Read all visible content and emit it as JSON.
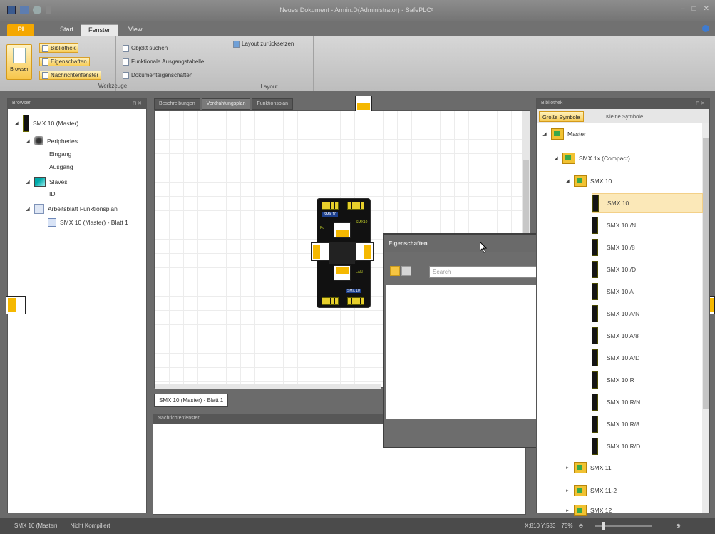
{
  "window": {
    "title": "Neues Dokument - Armin.D(Administrator) - SafePLC²",
    "controls": [
      "–",
      "□",
      "✕"
    ]
  },
  "ribbon": {
    "tabs": [
      "Pl",
      "Start",
      "Fenster",
      "View"
    ],
    "browser_button": "Browser",
    "group_werkzeuge": {
      "title": "Werkzeuge",
      "items": [
        "Bibliothek",
        "Eigenschaften",
        "Nachrichtenfenster"
      ]
    },
    "group_more": {
      "items": [
        "Objekt suchen",
        "Funktionale Ausgangstabelle",
        "Dokumenteigenschaften"
      ]
    },
    "group_layout": {
      "title": "Layout",
      "items": [
        "Layout zurücksetzen"
      ]
    }
  },
  "left_panel": {
    "title": "Browser",
    "tree": [
      {
        "label": "SMX 10 (Master)"
      },
      {
        "label": "Peripheries"
      },
      {
        "label": "Eingang"
      },
      {
        "label": "Ausgang"
      },
      {
        "label": "Slaves"
      },
      {
        "label": "ID"
      },
      {
        "label": "Arbeitsblatt Funktionsplan"
      },
      {
        "label": "SMX 10 (Master) - Blatt 1"
      }
    ]
  },
  "editor": {
    "tabs": [
      "Beschreibungen",
      "Verdrahtungsplan",
      "Funktionsplan"
    ],
    "sheet_tab": "SMX 10 (Master) - Blatt 1",
    "device": {
      "label_top": "SMX 10",
      "label_bottom": "SMX 10",
      "text_left": "Pd",
      "text_right": "SMX10",
      "text_right2": "LAN"
    }
  },
  "messages_panel": {
    "title": "Nachrichtenfenster"
  },
  "properties": {
    "title": "Eigenschaften",
    "search_placeholder": "Search",
    "controls": "☐ ✕"
  },
  "library": {
    "title": "Bibliothek",
    "tabs": [
      "Große Symbole",
      "Kleine Symbole"
    ],
    "tree": [
      {
        "label": "Master"
      },
      {
        "label": "SMX 1x (Compact)"
      },
      {
        "label": "SMX 10"
      },
      {
        "label": "SMX 11"
      },
      {
        "label": "SMX 11-2"
      },
      {
        "label": "SMX 12"
      }
    ],
    "items": [
      "SMX 10",
      "SMX 10 /N",
      "SMX 10 /8",
      "SMX 10 /D",
      "SMX 10 A",
      "SMX 10 A/N",
      "SMX 10 A/8",
      "SMX 10 A/D",
      "SMX 10 R",
      "SMX 10 R/N",
      "SMX 10 R/8",
      "SMX 10 R/D"
    ]
  },
  "statusbar": {
    "device": "SMX 10 (Master)",
    "compile_state": "Nicht Kompiliert",
    "coords": "X:810 Y:583",
    "zoom": "75%"
  }
}
